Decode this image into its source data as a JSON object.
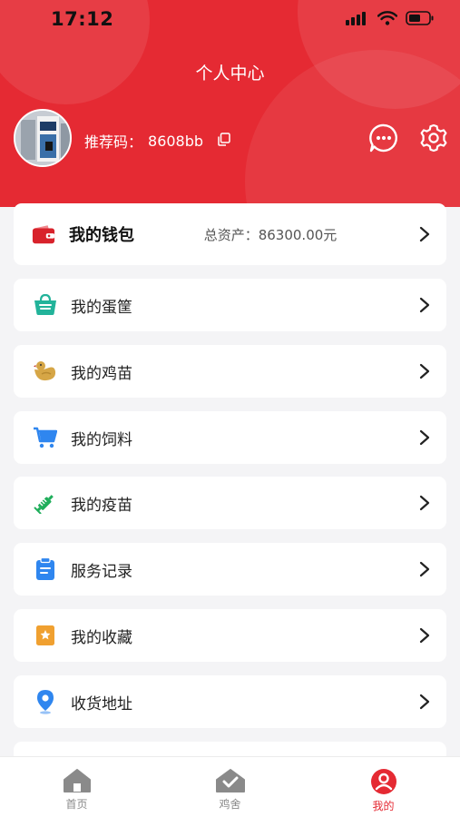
{
  "status": {
    "time": "17:12"
  },
  "header": {
    "title": "个人中心",
    "referral_label": "推荐码：",
    "referral_code": "8608bb"
  },
  "wallet": {
    "title": "我的钱包",
    "total_label": "总资产：",
    "total_value": "86300.00元"
  },
  "menu": [
    {
      "label": "我的蛋筐",
      "icon": "egg-basket-icon"
    },
    {
      "label": "我的鸡苗",
      "icon": "chick-icon"
    },
    {
      "label": "我的饲料",
      "icon": "cart-icon"
    },
    {
      "label": "我的疫苗",
      "icon": "syringe-icon"
    },
    {
      "label": "服务记录",
      "icon": "clipboard-icon"
    },
    {
      "label": "我的收藏",
      "icon": "bookmark-star-icon"
    },
    {
      "label": "收货地址",
      "icon": "location-pin-icon"
    }
  ],
  "tabs": [
    {
      "label": "首页",
      "icon": "home-icon",
      "active": false
    },
    {
      "label": "鸡舍",
      "icon": "coop-icon",
      "active": false
    },
    {
      "label": "我的",
      "icon": "profile-icon",
      "active": true
    }
  ],
  "colors": {
    "brand": "#e52a33",
    "background": "#f4f4f6",
    "wallet": "#d8222b",
    "basket": "#22b39a",
    "chick": "#d6a646",
    "cart": "#2f86ef",
    "syringe": "#1fae5b",
    "clipboard": "#2f86ef",
    "bookmark": "#f0a030",
    "pin": "#2f86ef"
  }
}
